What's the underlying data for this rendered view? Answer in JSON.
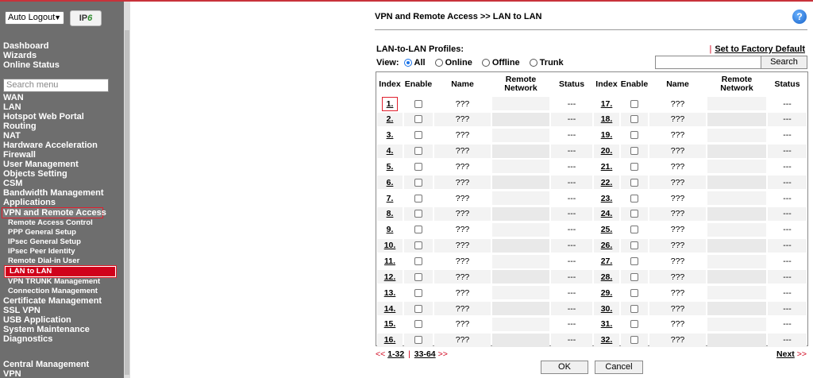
{
  "sidebar": {
    "logout_select": "Auto Logout",
    "ipv6_prefix": "IP",
    "ipv6_suffix": "6",
    "top_items": [
      "Dashboard",
      "Wizards",
      "Online Status"
    ],
    "search_placeholder": "Search menu",
    "menu_items": [
      "WAN",
      "LAN",
      "Hotspot Web Portal",
      "Routing",
      "NAT",
      "Hardware Acceleration",
      "Firewall",
      "User Management",
      "Objects Setting",
      "CSM",
      "Bandwidth Management",
      "Applications"
    ],
    "active_item": "VPN and Remote Access",
    "sub_items": [
      "Remote Access Control",
      "PPP General Setup",
      "IPsec General Setup",
      "IPsec Peer Identity",
      "Remote Dial-in User"
    ],
    "active_sub_item": "LAN to LAN",
    "sub_items_after": [
      "VPN TRUNK Management",
      "Connection Management"
    ],
    "menu_items_after": [
      "Certificate Management",
      "SSL VPN",
      "USB Application",
      "System Maintenance",
      "Diagnostics"
    ],
    "bottom_items": [
      "Central Management",
      "VPN"
    ]
  },
  "main": {
    "title": "VPN and Remote Access >> LAN to LAN",
    "help_icon": "?",
    "profiles_label": "LAN-to-LAN Profiles:",
    "factory_bar": "|",
    "factory_link": "Set to Factory Default",
    "view_label": "View:",
    "view_options": [
      "All",
      "Online",
      "Offline",
      "Trunk"
    ],
    "view_selected": "All",
    "search_button": "Search",
    "columns": {
      "index": "Index",
      "enable": "Enable",
      "name": "Name",
      "remote_network_1": "Remote",
      "remote_network_2": "Network",
      "status": "Status"
    },
    "left_rows": [
      {
        "index": "1.",
        "name": "???",
        "status": "---"
      },
      {
        "index": "2.",
        "name": "???",
        "status": "---"
      },
      {
        "index": "3.",
        "name": "???",
        "status": "---"
      },
      {
        "index": "4.",
        "name": "???",
        "status": "---"
      },
      {
        "index": "5.",
        "name": "???",
        "status": "---"
      },
      {
        "index": "6.",
        "name": "???",
        "status": "---"
      },
      {
        "index": "7.",
        "name": "???",
        "status": "---"
      },
      {
        "index": "8.",
        "name": "???",
        "status": "---"
      },
      {
        "index": "9.",
        "name": "???",
        "status": "---"
      },
      {
        "index": "10.",
        "name": "???",
        "status": "---"
      },
      {
        "index": "11.",
        "name": "???",
        "status": "---"
      },
      {
        "index": "12.",
        "name": "???",
        "status": "---"
      },
      {
        "index": "13.",
        "name": "???",
        "status": "---"
      },
      {
        "index": "14.",
        "name": "???",
        "status": "---"
      },
      {
        "index": "15.",
        "name": "???",
        "status": "---"
      },
      {
        "index": "16.",
        "name": "???",
        "status": "---"
      }
    ],
    "right_rows": [
      {
        "index": "17.",
        "name": "???",
        "status": "---"
      },
      {
        "index": "18.",
        "name": "???",
        "status": "---"
      },
      {
        "index": "19.",
        "name": "???",
        "status": "---"
      },
      {
        "index": "20.",
        "name": "???",
        "status": "---"
      },
      {
        "index": "21.",
        "name": "???",
        "status": "---"
      },
      {
        "index": "22.",
        "name": "???",
        "status": "---"
      },
      {
        "index": "23.",
        "name": "???",
        "status": "---"
      },
      {
        "index": "24.",
        "name": "???",
        "status": "---"
      },
      {
        "index": "25.",
        "name": "???",
        "status": "---"
      },
      {
        "index": "26.",
        "name": "???",
        "status": "---"
      },
      {
        "index": "27.",
        "name": "???",
        "status": "---"
      },
      {
        "index": "28.",
        "name": "???",
        "status": "---"
      },
      {
        "index": "29.",
        "name": "???",
        "status": "---"
      },
      {
        "index": "30.",
        "name": "???",
        "status": "---"
      },
      {
        "index": "31.",
        "name": "???",
        "status": "---"
      },
      {
        "index": "32.",
        "name": "???",
        "status": "---"
      }
    ],
    "pager": {
      "prev_arrow": "<<",
      "page_1": "1-32",
      "separator": "|",
      "page_2": "33-64",
      "next_arrow": ">>",
      "next_label": "Next"
    },
    "ok_button": "OK",
    "cancel_button": "Cancel"
  },
  "colors": {
    "accent_red": "#d0021b",
    "sidebar_bg": "#6e6e6e",
    "help_blue": "#1560c8"
  }
}
